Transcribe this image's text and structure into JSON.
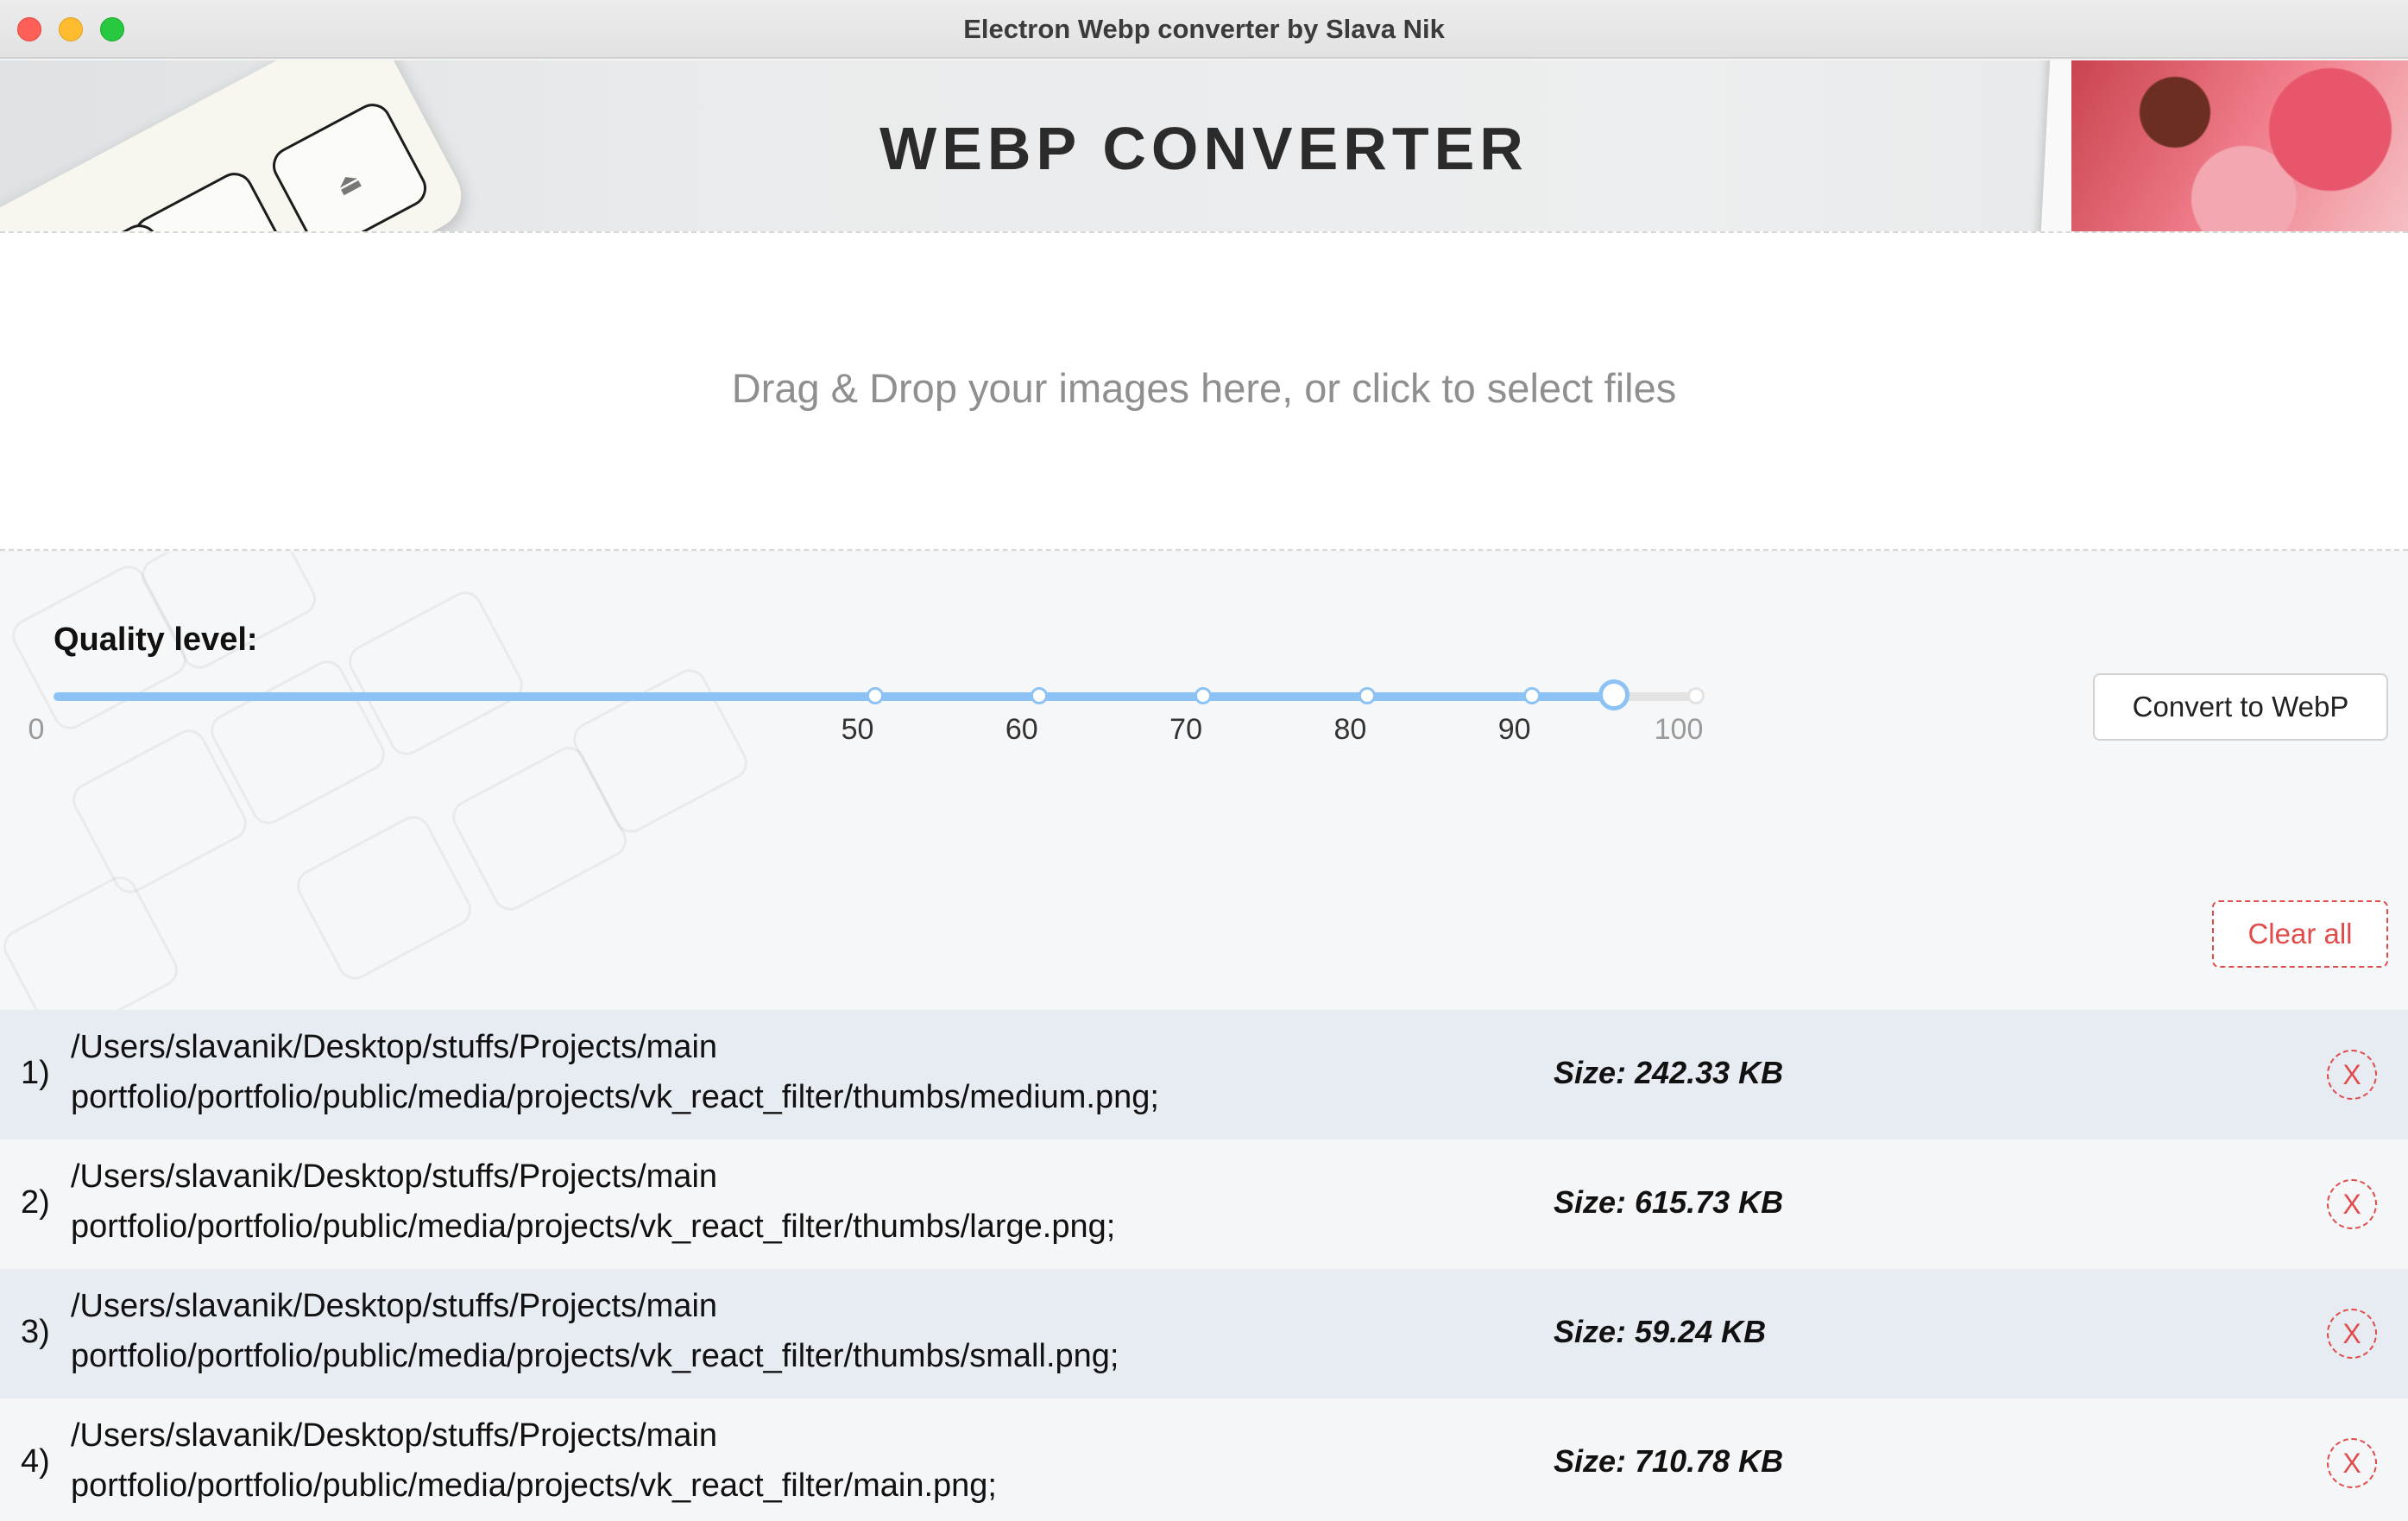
{
  "window": {
    "title": "Electron Webp converter by Slava Nik"
  },
  "header": {
    "title": "WEBP CONVERTER"
  },
  "dropzone": {
    "text": "Drag & Drop your images here, or click to select files"
  },
  "quality": {
    "label": "Quality level:",
    "value": 95,
    "min": 0,
    "max": 100,
    "marks": [
      {
        "value": 0,
        "label": "0"
      },
      {
        "value": 50,
        "label": "50"
      },
      {
        "value": 60,
        "label": "60"
      },
      {
        "value": 70,
        "label": "70"
      },
      {
        "value": 80,
        "label": "80"
      },
      {
        "value": 90,
        "label": "90"
      },
      {
        "value": 100,
        "label": "100"
      }
    ],
    "accent_color": "#8dc2f5"
  },
  "actions": {
    "convert_label": "Convert to WebP",
    "clear_label": "Clear all",
    "danger_color": "#e04b4b"
  },
  "files": [
    {
      "index": "1)",
      "path_line1": "/Users/slavanik/Desktop/stuffs/Projects/main",
      "path_line2": "portfolio/portfolio/public/media/projects/vk_react_filter/thumbs/medium.png;",
      "size": "Size: 242.33 KB",
      "remove_label": "X"
    },
    {
      "index": "2)",
      "path_line1": "/Users/slavanik/Desktop/stuffs/Projects/main",
      "path_line2": "portfolio/portfolio/public/media/projects/vk_react_filter/thumbs/large.png;",
      "size": "Size: 615.73 KB",
      "remove_label": "X"
    },
    {
      "index": "3)",
      "path_line1": "/Users/slavanik/Desktop/stuffs/Projects/main",
      "path_line2": "portfolio/portfolio/public/media/projects/vk_react_filter/thumbs/small.png;",
      "size": "Size: 59.24 KB",
      "remove_label": "X"
    },
    {
      "index": "4)",
      "path_line1": "/Users/slavanik/Desktop/stuffs/Projects/main",
      "path_line2": "portfolio/portfolio/public/media/projects/vk_react_filter/main.png;",
      "size": "Size: 710.78 KB",
      "remove_label": "X"
    }
  ]
}
